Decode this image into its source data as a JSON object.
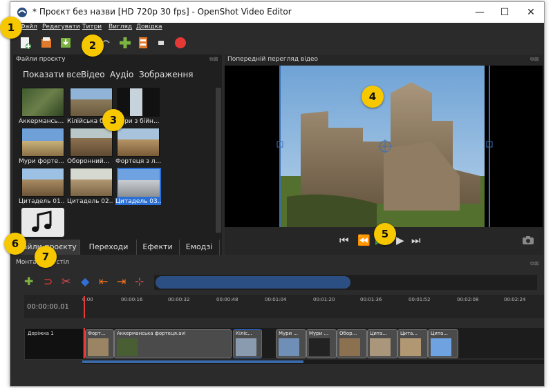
{
  "window": {
    "title": "* Проєкт без назви [HD 720p 30 fps] - OpenShot Video Editor",
    "minimize": "—",
    "maximize": "☐",
    "close": "✕"
  },
  "menu": [
    "Файл",
    "Редагувати",
    "Титри",
    "Вигляд",
    "Довідка"
  ],
  "panels": {
    "project_files": "Файли проєкту",
    "preview": "Попередній перегляд відео",
    "timeline": "Монтажний стіл"
  },
  "filters": [
    "Показати все",
    "Відео",
    "Аудіо",
    "Зображення"
  ],
  "files": [
    {
      "label": "Аккермансь..."
    },
    {
      "label": "Кілійська б..."
    },
    {
      "label": "Мури з бійн..."
    },
    {
      "label": "Мури форте..."
    },
    {
      "label": "Оборонний..."
    },
    {
      "label": "Фортеця з л..."
    },
    {
      "label": "Цитадель 01..."
    },
    {
      "label": "Цитадель 02..."
    },
    {
      "label": "Цитадель 03...",
      "selected": true
    },
    {
      "label": ""
    }
  ],
  "bottom_tabs": [
    "Файли проєкту",
    "Переходи",
    "Ефекти",
    "Емодзі"
  ],
  "timeline": {
    "timecode": "00:00:00,01",
    "ticks": [
      "0:00",
      "00:00:16",
      "00:00:32",
      "00:00:48",
      "00:01:04",
      "00:01:20",
      "00:01:36",
      "00:01:52",
      "00:02:08",
      "00:02:24"
    ],
    "track_name": "Доріжка 1",
    "clips": [
      "Форт...",
      "Аккерманська фортеця.avi",
      "Кіліс...",
      "Мури ...",
      "Мури ...",
      "Обор...",
      "Цита...",
      "Цита...",
      "Цита..."
    ]
  },
  "badges": [
    "1",
    "2",
    "3",
    "4",
    "5",
    "6",
    "7"
  ],
  "colors": {
    "accent": "#2a6fd6",
    "badge": "#f7c800",
    "playhead": "#e53935"
  }
}
